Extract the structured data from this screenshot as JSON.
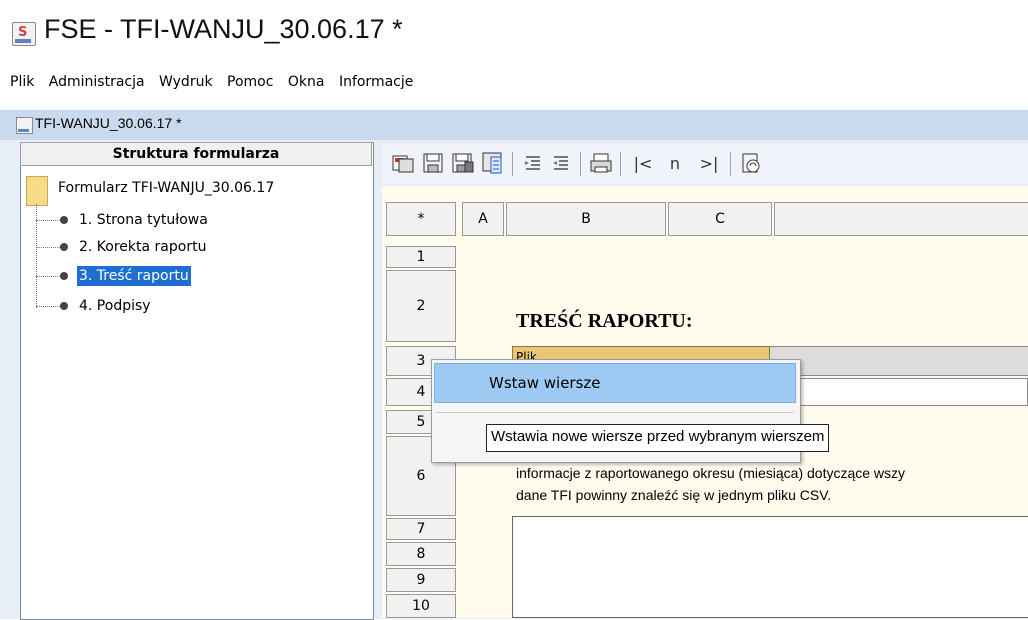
{
  "window": {
    "title": "FSE - TFI-WANJU_30.06.17 *",
    "icon": "java-cup-icon"
  },
  "menubar": {
    "items": [
      "Plik",
      "Administracja",
      "Wydruk",
      "Pomoc",
      "Okna",
      "Informacje"
    ]
  },
  "inner_window": {
    "title": "TFI-WANJU_30.06.17 *"
  },
  "tree": {
    "header": "Struktura formularza",
    "root": "Formularz TFI-WANJU_30.06.17",
    "items": [
      {
        "label": "1. Strona tytułowa",
        "selected": false
      },
      {
        "label": "2. Korekta raportu",
        "selected": false
      },
      {
        "label": "3. Treść raportu",
        "selected": true
      },
      {
        "label": "4. Podpisy",
        "selected": false
      }
    ]
  },
  "toolbar": {
    "buttons": [
      "copy-form-icon",
      "save-icon",
      "save-as-icon",
      "import-icon",
      "indent-right-icon",
      "indent-left-icon",
      "print-icon",
      "first-page-button",
      "page-number-button",
      "last-page-button",
      "refresh-icon"
    ],
    "first_label": "|<",
    "page_label": "n",
    "last_label": ">|"
  },
  "grid": {
    "corner": "*",
    "columns": [
      "A",
      "B",
      "C"
    ],
    "rows": [
      "1",
      "2",
      "3",
      "4",
      "5",
      "6",
      "7",
      "8",
      "9",
      "10"
    ],
    "title": "TREŚĆ RAPORTU:",
    "row3_text": "Plik",
    "info_line1": "informacje z raportowanego okresu (miesiąca) dotyczące wszy",
    "info_line2": "dane TFI powinny znaleźć się w jednym pliku CSV."
  },
  "context_menu": {
    "item": "Wstaw wiersze",
    "tooltip": "Wstawia nowe wiersze przed wybranym wierszem"
  }
}
